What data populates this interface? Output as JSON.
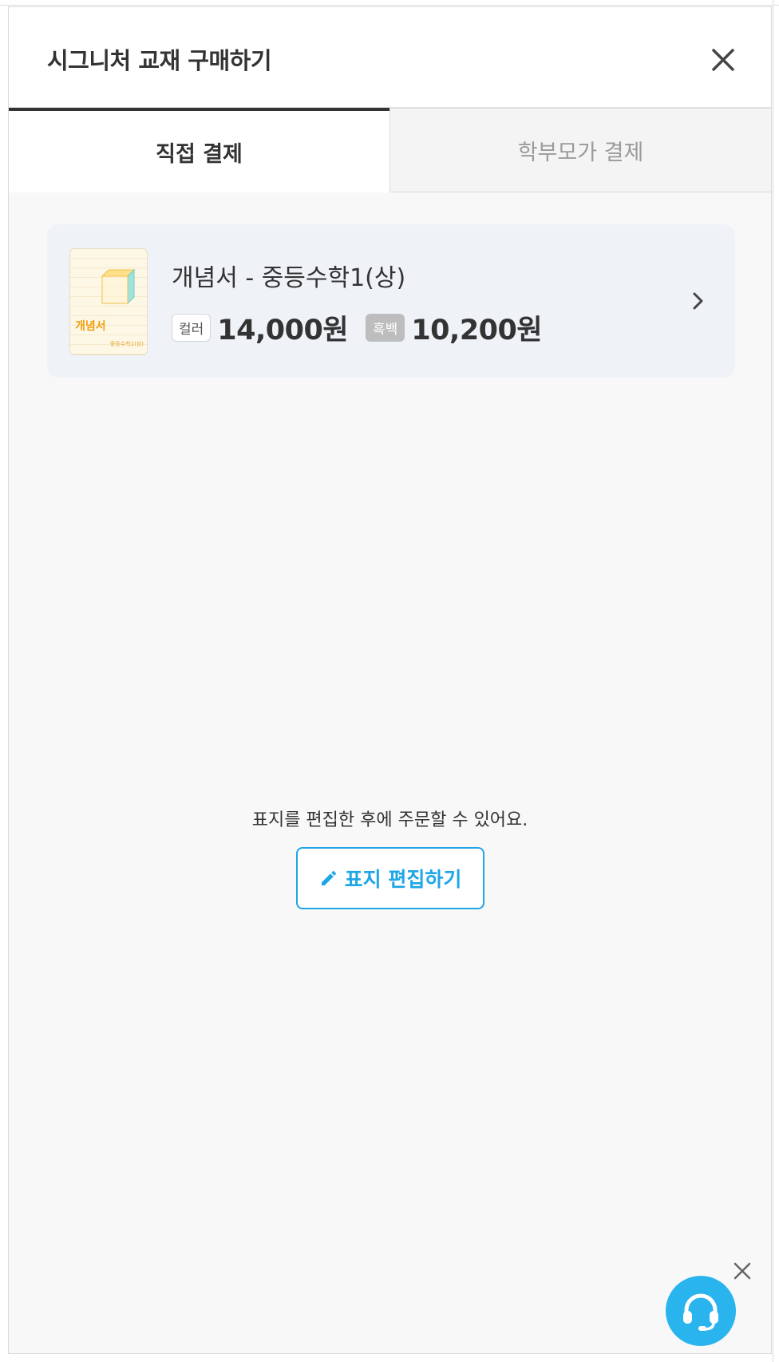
{
  "modal": {
    "title": "시그니처 교재 구매하기",
    "close_icon": "close-icon"
  },
  "tabs": [
    {
      "label": "직접 결제",
      "active": true
    },
    {
      "label": "학부모가 결제",
      "active": false
    }
  ],
  "book": {
    "thumbnail_title": "개념서",
    "thumbnail_subtitle": "중등수학1(상)",
    "name": "개념서 - 중등수학1(상)",
    "color_badge": "컬러",
    "color_price": "14,000원",
    "bw_badge": "흑백",
    "bw_price": "10,200원",
    "chevron_icon": "chevron-right-icon"
  },
  "notice": "표지를 편집한 후에 주문할 수 있어요.",
  "edit_button": {
    "label": "표지 편집하기",
    "icon": "pencil-icon"
  },
  "support": {
    "icon": "headset-icon",
    "dismiss_icon": "close-icon"
  },
  "colors": {
    "accent": "#1ea6e6",
    "support_bg": "#2ab4ee",
    "card_bg": "#eff3f8"
  }
}
